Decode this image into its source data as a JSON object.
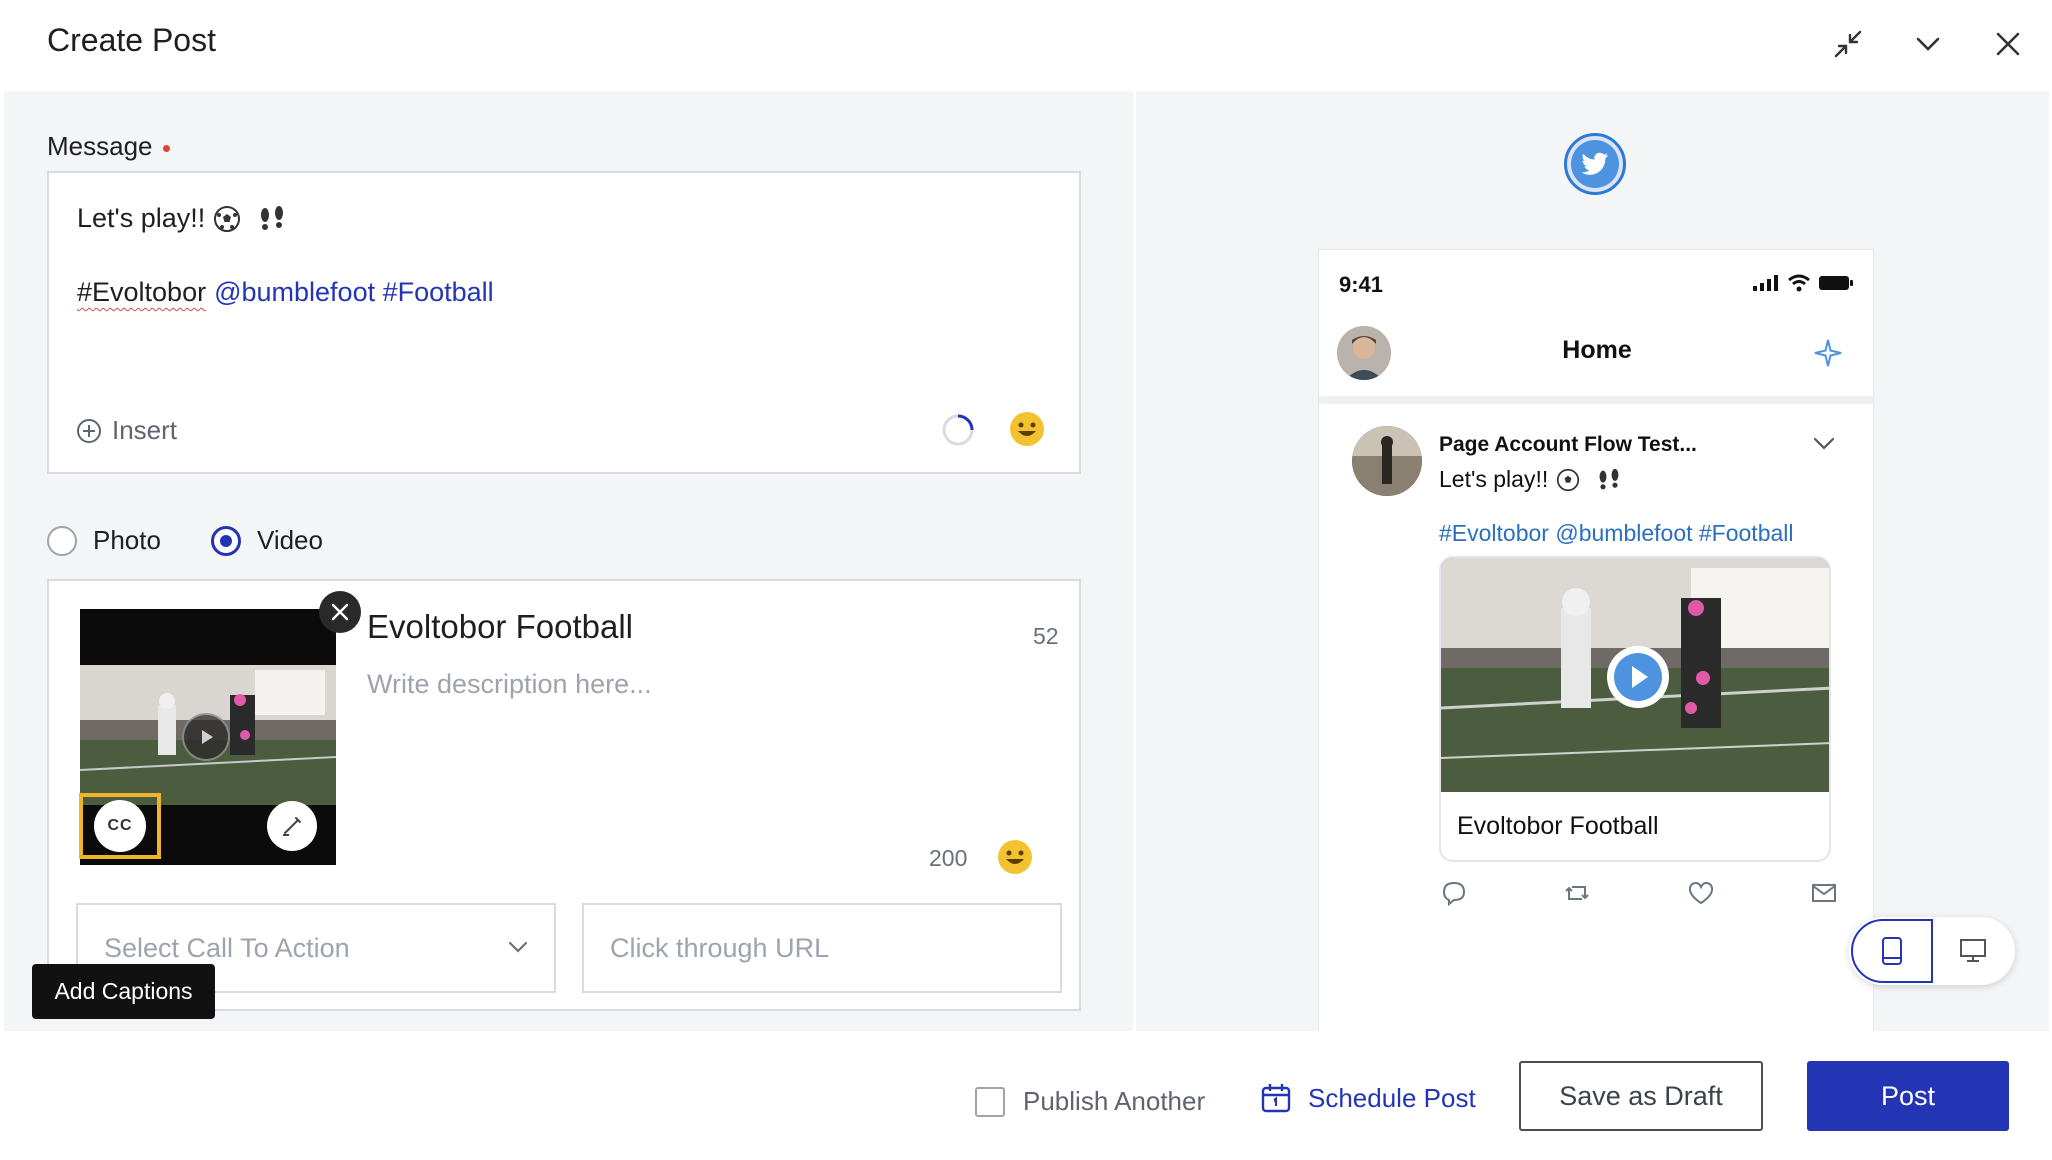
{
  "header": {
    "title": "Create Post",
    "icons": [
      "collapse-icon",
      "chevron-down-icon",
      "close-icon"
    ]
  },
  "message": {
    "label": "Message",
    "line1": "Let's play!!",
    "line1_emojis": [
      "soccer-ball-icon",
      "footprints-icon"
    ],
    "line2_plain": "#Evoltobor",
    "line2_links": "@bumblefoot #Football",
    "insert_label": "Insert"
  },
  "media_type": {
    "options": [
      "Photo",
      "Video"
    ],
    "selected": "Video"
  },
  "video": {
    "title": "Evoltobor Football",
    "title_count": "52",
    "description_placeholder": "Write description here...",
    "description_count": "200",
    "cc_label": "CC",
    "cta_placeholder": "Select Call To Action",
    "url_placeholder": "Click through URL",
    "tooltip": "Add Captions"
  },
  "preview": {
    "network": "twitter",
    "time": "9:41",
    "home_label": "Home",
    "account_name": "Page Account Flow Test...",
    "tweet_text": "Let's play!!",
    "tweet_hashtags": "#Evoltobor @bumblefoot #Football",
    "card_title": "Evoltobor Football",
    "actions": [
      "reply-icon",
      "retweet-icon",
      "like-icon",
      "share-icon"
    ]
  },
  "footer": {
    "publish_another": "Publish Another",
    "schedule_post": "Schedule Post",
    "save_draft": "Save as Draft",
    "post": "Post"
  },
  "colors": {
    "primary": "#2335b5",
    "link": "#2a6fbe",
    "highlight": "#f0b429",
    "required": "#e0413c",
    "emoji": "#f2c230",
    "panel_bg": "#f4f5f7"
  }
}
